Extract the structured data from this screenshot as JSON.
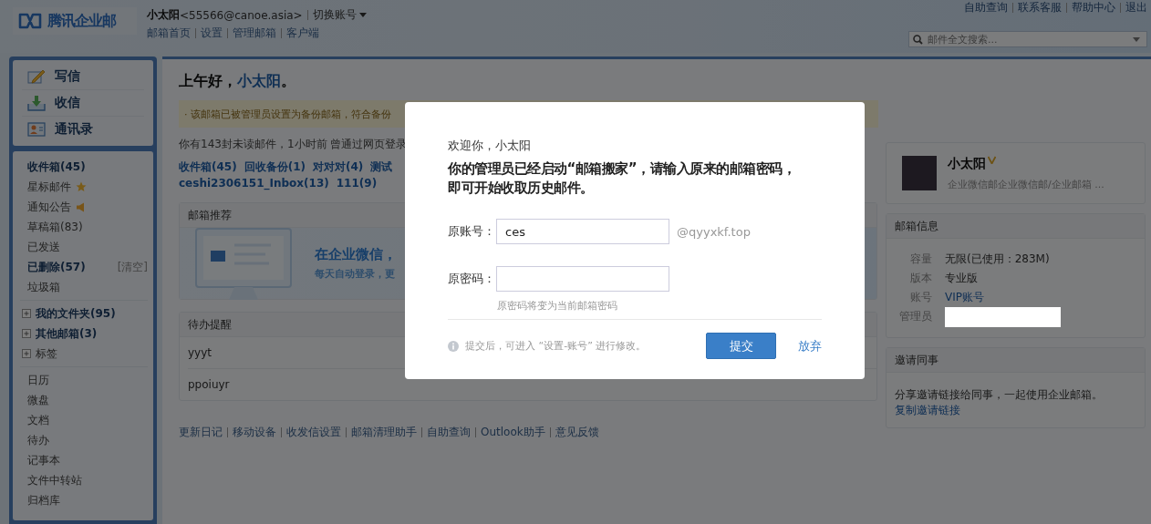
{
  "header": {
    "logo": "腾讯企业邮",
    "user_name": "小太阳",
    "user_email": "<55566@canoe.asia>",
    "switch_account": "切换账号",
    "nav_links": [
      "邮箱首页",
      "设置",
      "管理邮箱",
      "客户端"
    ],
    "top_links": [
      "自助查询",
      "联系客服",
      "帮助中心",
      "退出"
    ],
    "search": {
      "placeholder": "邮件全文搜索..."
    }
  },
  "sidebar": {
    "actions": [
      {
        "kind": "compose",
        "label": "写信"
      },
      {
        "kind": "receive",
        "label": "收信"
      },
      {
        "kind": "contacts",
        "label": "通讯录"
      }
    ],
    "mailboxes": [
      {
        "label": "收件箱(45)",
        "bold": true,
        "kind": "plain"
      },
      {
        "label": "星标邮件",
        "kind": "starred",
        "bold": false
      },
      {
        "label": "通知公告",
        "kind": "announcement",
        "bold": false
      },
      {
        "label": "草稿箱(83)",
        "bold": false,
        "kind": "plain"
      },
      {
        "label": "已发送",
        "bold": false,
        "kind": "plain"
      },
      {
        "label": "已删除(57)",
        "bold": true,
        "kind": "plain",
        "action": "[清空]"
      },
      {
        "label": "垃圾箱",
        "bold": false,
        "kind": "plain"
      }
    ],
    "groups": [
      {
        "label": "我的文件夹(95)",
        "bold": true,
        "expanded": false
      },
      {
        "label": "其他邮箱(3)",
        "bold": true,
        "expanded": false
      },
      {
        "label": "标签",
        "bold": false,
        "expanded": false
      }
    ],
    "tools": [
      "日历",
      "微盘",
      "文档",
      "待办",
      "记事本",
      "文件中转站",
      "归档库"
    ]
  },
  "main": {
    "greeting": {
      "prefix": "上午好，",
      "name": "小太阳",
      "suffix": "。"
    },
    "notice": "· 该邮箱已被管理员设置为备份邮箱，符合备份",
    "unread": "你有143封未读邮件，1小时前 曾通过网页登录",
    "folder_link_rows": [
      [
        "收件箱(45)",
        "回收备份(1)",
        "对对对(4)",
        "测试"
      ],
      [
        "ceshi2306151_Inbox(13)",
        "111(9)"
      ]
    ],
    "recommend": {
      "title": "邮箱推荐",
      "headline": "在企业微信，",
      "subline": "每天自动登录，更"
    },
    "todo": {
      "title": "待办提醒",
      "items": [
        "yyyt",
        "ppoiuyr"
      ]
    },
    "footer_links": [
      "更新日记",
      "移动设备",
      "收发信设置",
      "邮箱清理助手",
      "自助查询",
      "Outlook助手",
      "意见反馈"
    ]
  },
  "right": {
    "profile": {
      "name": "小太阳",
      "signature": "企业微信邮企业微信邮/企业邮箱 ..."
    },
    "mailbox_info": {
      "title": "邮箱信息",
      "rows": [
        {
          "label": "容量",
          "value": "无限(已使用：283M)",
          "kind": "text"
        },
        {
          "label": "版本",
          "value": "专业版",
          "kind": "text"
        },
        {
          "label": "账号",
          "value": "VIP账号",
          "kind": "link"
        },
        {
          "label": "管理员",
          "kind": "redacted"
        }
      ]
    },
    "invite": {
      "title": "邀请同事",
      "text": "分享邀请链接给同事，一起使用企业邮箱。",
      "link": "复制邀请链接"
    }
  },
  "dialog": {
    "welcome": "欢迎你，小太阳",
    "title_lines": [
      "你的管理员已经启动“邮箱搬家”，请输入原来的邮箱密码，",
      "即可开始收取历史邮件。"
    ],
    "account": {
      "label": "原账号：",
      "value": "ces",
      "suffix": "@qyyxkf.top"
    },
    "password": {
      "label": "原密码：",
      "hint": "原密码将变为当前邮箱密码"
    },
    "note": "提交后，可进入 “设置-账号” 进行修改。",
    "submit": "提交",
    "cancel": "放弃"
  }
}
